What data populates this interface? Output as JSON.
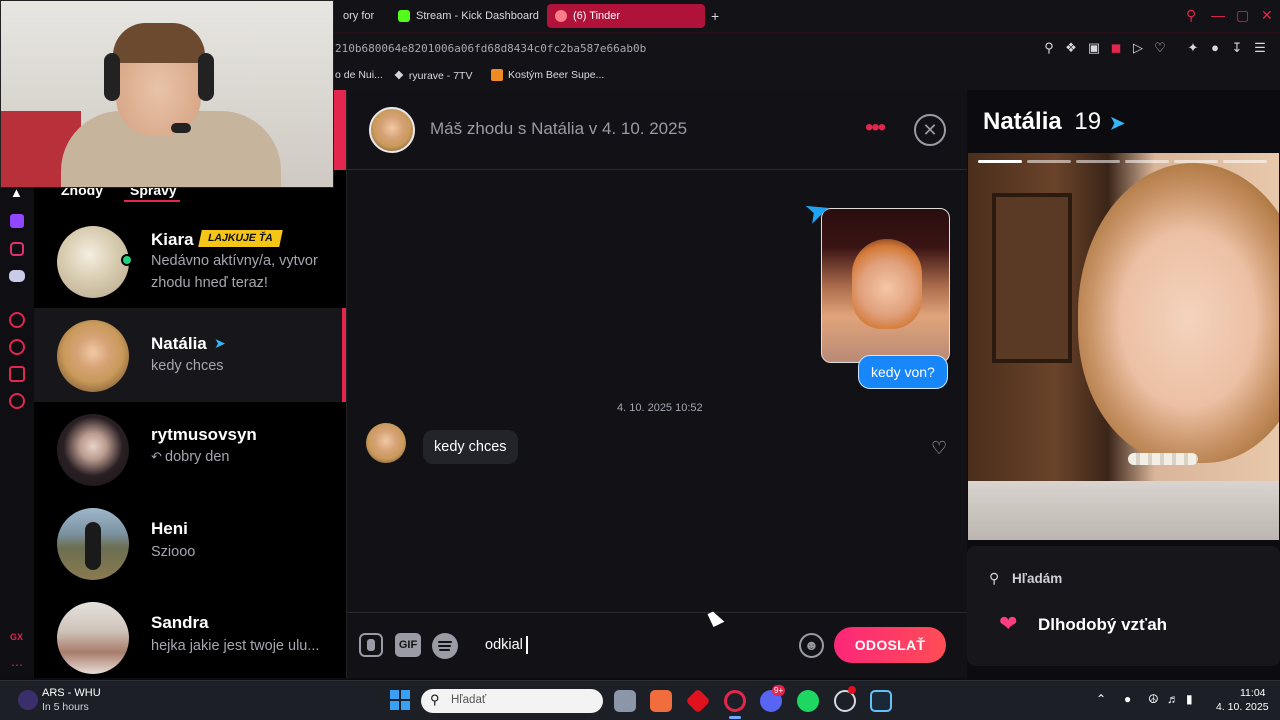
{
  "browser": {
    "tabs": [
      {
        "label": "ory for Bl",
        "active": false
      },
      {
        "label": "Stream - Kick Dashboard",
        "active": false
      },
      {
        "label": "(6) Tinder",
        "active": true
      }
    ],
    "new_tab_label": "+",
    "url": "210b680064e8201006a06fd68d8434c0fc2ba587e66ab0b",
    "bookmarks": [
      {
        "label": "o de Nui..."
      },
      {
        "label": "ryurave - 7TV"
      },
      {
        "label": "Kostým Beer Supe..."
      }
    ]
  },
  "conversations": {
    "tabs": [
      {
        "label": "Zhody"
      },
      {
        "label": "Správy"
      }
    ],
    "items": [
      {
        "name": "Kiara",
        "badge": "LAJKUJE ŤA",
        "subtitle": "Nedávno aktívny/a, vytvor zhodu hneď teraz!"
      },
      {
        "name": "Natália",
        "subtitle": "kedy chces"
      },
      {
        "name": "rytmusovsyn",
        "subtitle": "dobry den"
      },
      {
        "name": "Heni",
        "subtitle": "Sziooo"
      },
      {
        "name": "Sandra",
        "subtitle": "hejka jakie jest twoje ulu..."
      }
    ],
    "sidebar_bottom_label": "GX"
  },
  "chat": {
    "header_title": "Máš zhodu s Natália v 4. 10. 2025",
    "sent_message": "kedy von?",
    "timestamp": "4. 10. 2025 10:52",
    "received_message": "kedy chces",
    "composer": {
      "gif_label": "GIF",
      "input_value": "odkial",
      "send_label": "ODOSLAŤ"
    }
  },
  "profile": {
    "name": "Natália",
    "age": "19",
    "looking_for_label": "Hľadám",
    "looking_for_value": "Dlhodobý vzťah"
  },
  "taskbar": {
    "weather_title": "ARS - WHU",
    "weather_sub": "In 5 hours",
    "search_placeholder": "Hľadať",
    "discord_badge": "9+",
    "time": "11:04",
    "date": "4. 10. 2025"
  },
  "colors": {
    "accent": "#e2264d",
    "tinder_gradient_start": "#fd267a",
    "tinder_gradient_end": "#ff4d55",
    "sent_bubble": "#1786f8",
    "badge_gold": "#f5c518"
  }
}
